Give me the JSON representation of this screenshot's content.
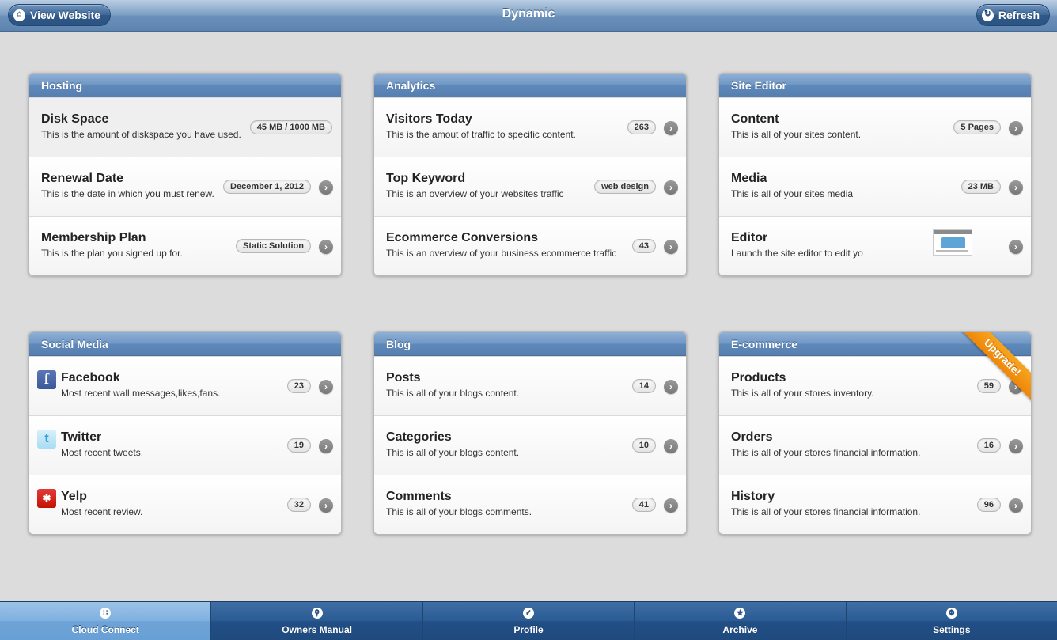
{
  "header": {
    "title": "Dynamic",
    "view_website": "View Website",
    "view_website_icon": "home-icon",
    "refresh": "Refresh",
    "refresh_icon": "refresh-icon"
  },
  "panels": {
    "hosting": {
      "title": "Hosting",
      "rows": [
        {
          "title": "Disk Space",
          "sub": "This is the amount of diskspace you have used.",
          "badge": "45 MB / 1000 MB"
        },
        {
          "title": "Renewal Date",
          "sub": "This is the date in which you must renew.",
          "badge": "December 1, 2012"
        },
        {
          "title": "Membership Plan",
          "sub": "This is the plan you signed up for.",
          "badge": "Static Solution"
        }
      ]
    },
    "analytics": {
      "title": "Analytics",
      "rows": [
        {
          "title": "Visitors Today",
          "sub": "This is the amout of traffic to specific content.",
          "badge": "263"
        },
        {
          "title": "Top Keyword",
          "sub": "This is an overview of your websites traffic",
          "badge": "web design"
        },
        {
          "title": "Ecommerce Conversions",
          "sub": "This is an overview of your business ecommerce traffic",
          "badge": "43"
        }
      ]
    },
    "site_editor": {
      "title": "Site Editor",
      "rows": [
        {
          "title": "Content",
          "sub": "This is all of your sites content.",
          "badge": "5 Pages"
        },
        {
          "title": "Media",
          "sub": "This is all of your sites media",
          "badge": "23 MB"
        },
        {
          "title": "Editor",
          "sub": "Launch the site editor to edit yo"
        }
      ]
    },
    "social_media": {
      "title": "Social Media",
      "rows": [
        {
          "title": "Facebook",
          "sub": "Most recent wall,messages,likes,fans.",
          "badge": "23",
          "icon": "facebook-icon"
        },
        {
          "title": "Twitter",
          "sub": "Most recent tweets.",
          "badge": "19",
          "icon": "twitter-icon"
        },
        {
          "title": "Yelp",
          "sub": "Most recent review.",
          "badge": "32",
          "icon": "yelp-icon"
        }
      ]
    },
    "blog": {
      "title": "Blog",
      "rows": [
        {
          "title": "Posts",
          "sub": "This is all of your blogs content.",
          "badge": "14"
        },
        {
          "title": "Categories",
          "sub": "This is all of your blogs content.",
          "badge": "10"
        },
        {
          "title": "Comments",
          "sub": "This is all of your blogs comments.",
          "badge": "41"
        }
      ]
    },
    "ecommerce": {
      "title": "E-commerce",
      "ribbon": "Upgrade!",
      "rows": [
        {
          "title": "Products",
          "sub": "This is all of your stores inventory.",
          "badge": "59"
        },
        {
          "title": "Orders",
          "sub": "This is all of your stores financial information.",
          "badge": "16"
        },
        {
          "title": "History",
          "sub": "This is all of your stores financial information.",
          "badge": "96"
        }
      ]
    }
  },
  "tabbar": {
    "tabs": [
      {
        "label": "Cloud Connect",
        "icon": "grid-icon",
        "active": true
      },
      {
        "label": "Owners Manual",
        "icon": "search-icon",
        "active": false
      },
      {
        "label": "Profile",
        "icon": "check-icon",
        "active": false
      },
      {
        "label": "Archive",
        "icon": "star-icon",
        "active": false
      },
      {
        "label": "Settings",
        "icon": "gear-icon",
        "active": false
      }
    ]
  },
  "colors": {
    "header_blue": "#6b90b9",
    "panel_header_blue": "#6f96c4",
    "tab_active": "#7fb0df",
    "ribbon_orange": "#f39514",
    "background": "#dcdcdc"
  }
}
